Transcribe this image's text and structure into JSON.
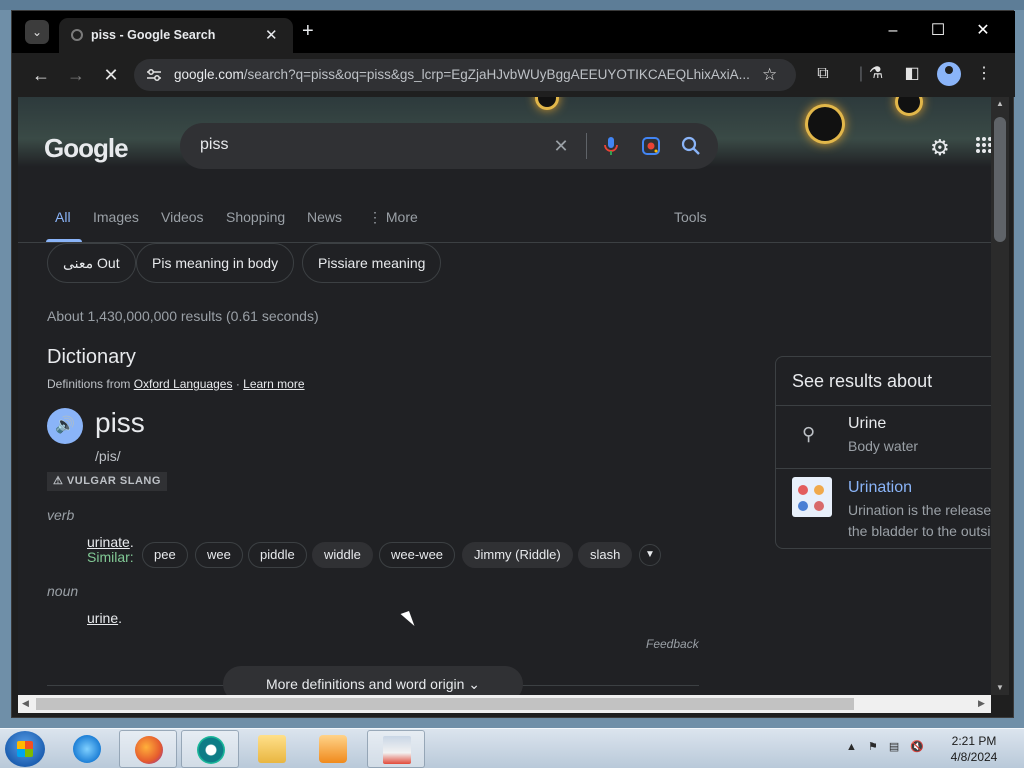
{
  "browser": {
    "tab_title": "piss - Google Search",
    "new_tab_symbol": "+",
    "url_domain": "google.com",
    "url_path": "/search?q=piss&oq=piss&gs_lcrp=EgZjaHJvbWUyBggAEEUYOTIKCAEQLhixAxiA..."
  },
  "search": {
    "query": "piss",
    "logo_text": "Google",
    "tabs": [
      {
        "label": "All",
        "active": true
      },
      {
        "label": "Images"
      },
      {
        "label": "Videos"
      },
      {
        "label": "Shopping"
      },
      {
        "label": "News"
      },
      {
        "label": "More"
      },
      {
        "label": "Tools"
      }
    ],
    "chips": [
      "معنى Out",
      "Pis meaning in body",
      "Pissiare meaning"
    ],
    "result_stats": "About 1,430,000,000 results (0.61 seconds)"
  },
  "dictionary": {
    "title": "Dictionary",
    "source_prefix": "Definitions from",
    "source_name": "Oxford Languages",
    "separator": "·",
    "learn_more": "Learn more",
    "word": "piss",
    "phonetic": "/pis/",
    "register_badge": "⚠ VULGAR SLANG",
    "senses": [
      {
        "pos": "verb",
        "definition": "urinate",
        "suffix": "."
      },
      {
        "pos": "noun",
        "definition": "urine",
        "suffix": "."
      }
    ],
    "similar_label": "Similar:",
    "synonyms": [
      "pee",
      "wee",
      "piddle",
      "widdle",
      "wee-wee",
      "Jimmy (Riddle)",
      "slash"
    ],
    "feedback": "Feedback",
    "more_definitions": "More definitions and word origin"
  },
  "side_panel": {
    "title": "See results about",
    "items": [
      {
        "name": "Urine",
        "subtitle": "Body water"
      },
      {
        "name": "Urination",
        "subtitle_line1": "Urination is the release",
        "subtitle_line2": "the bladder to the outsi"
      }
    ]
  },
  "taskbar": {
    "time": "2:21 PM",
    "date": "4/8/2024"
  },
  "colors": {
    "page_bg": "#202124",
    "accent": "#8ab4f8",
    "similar_green": "#81c995"
  }
}
